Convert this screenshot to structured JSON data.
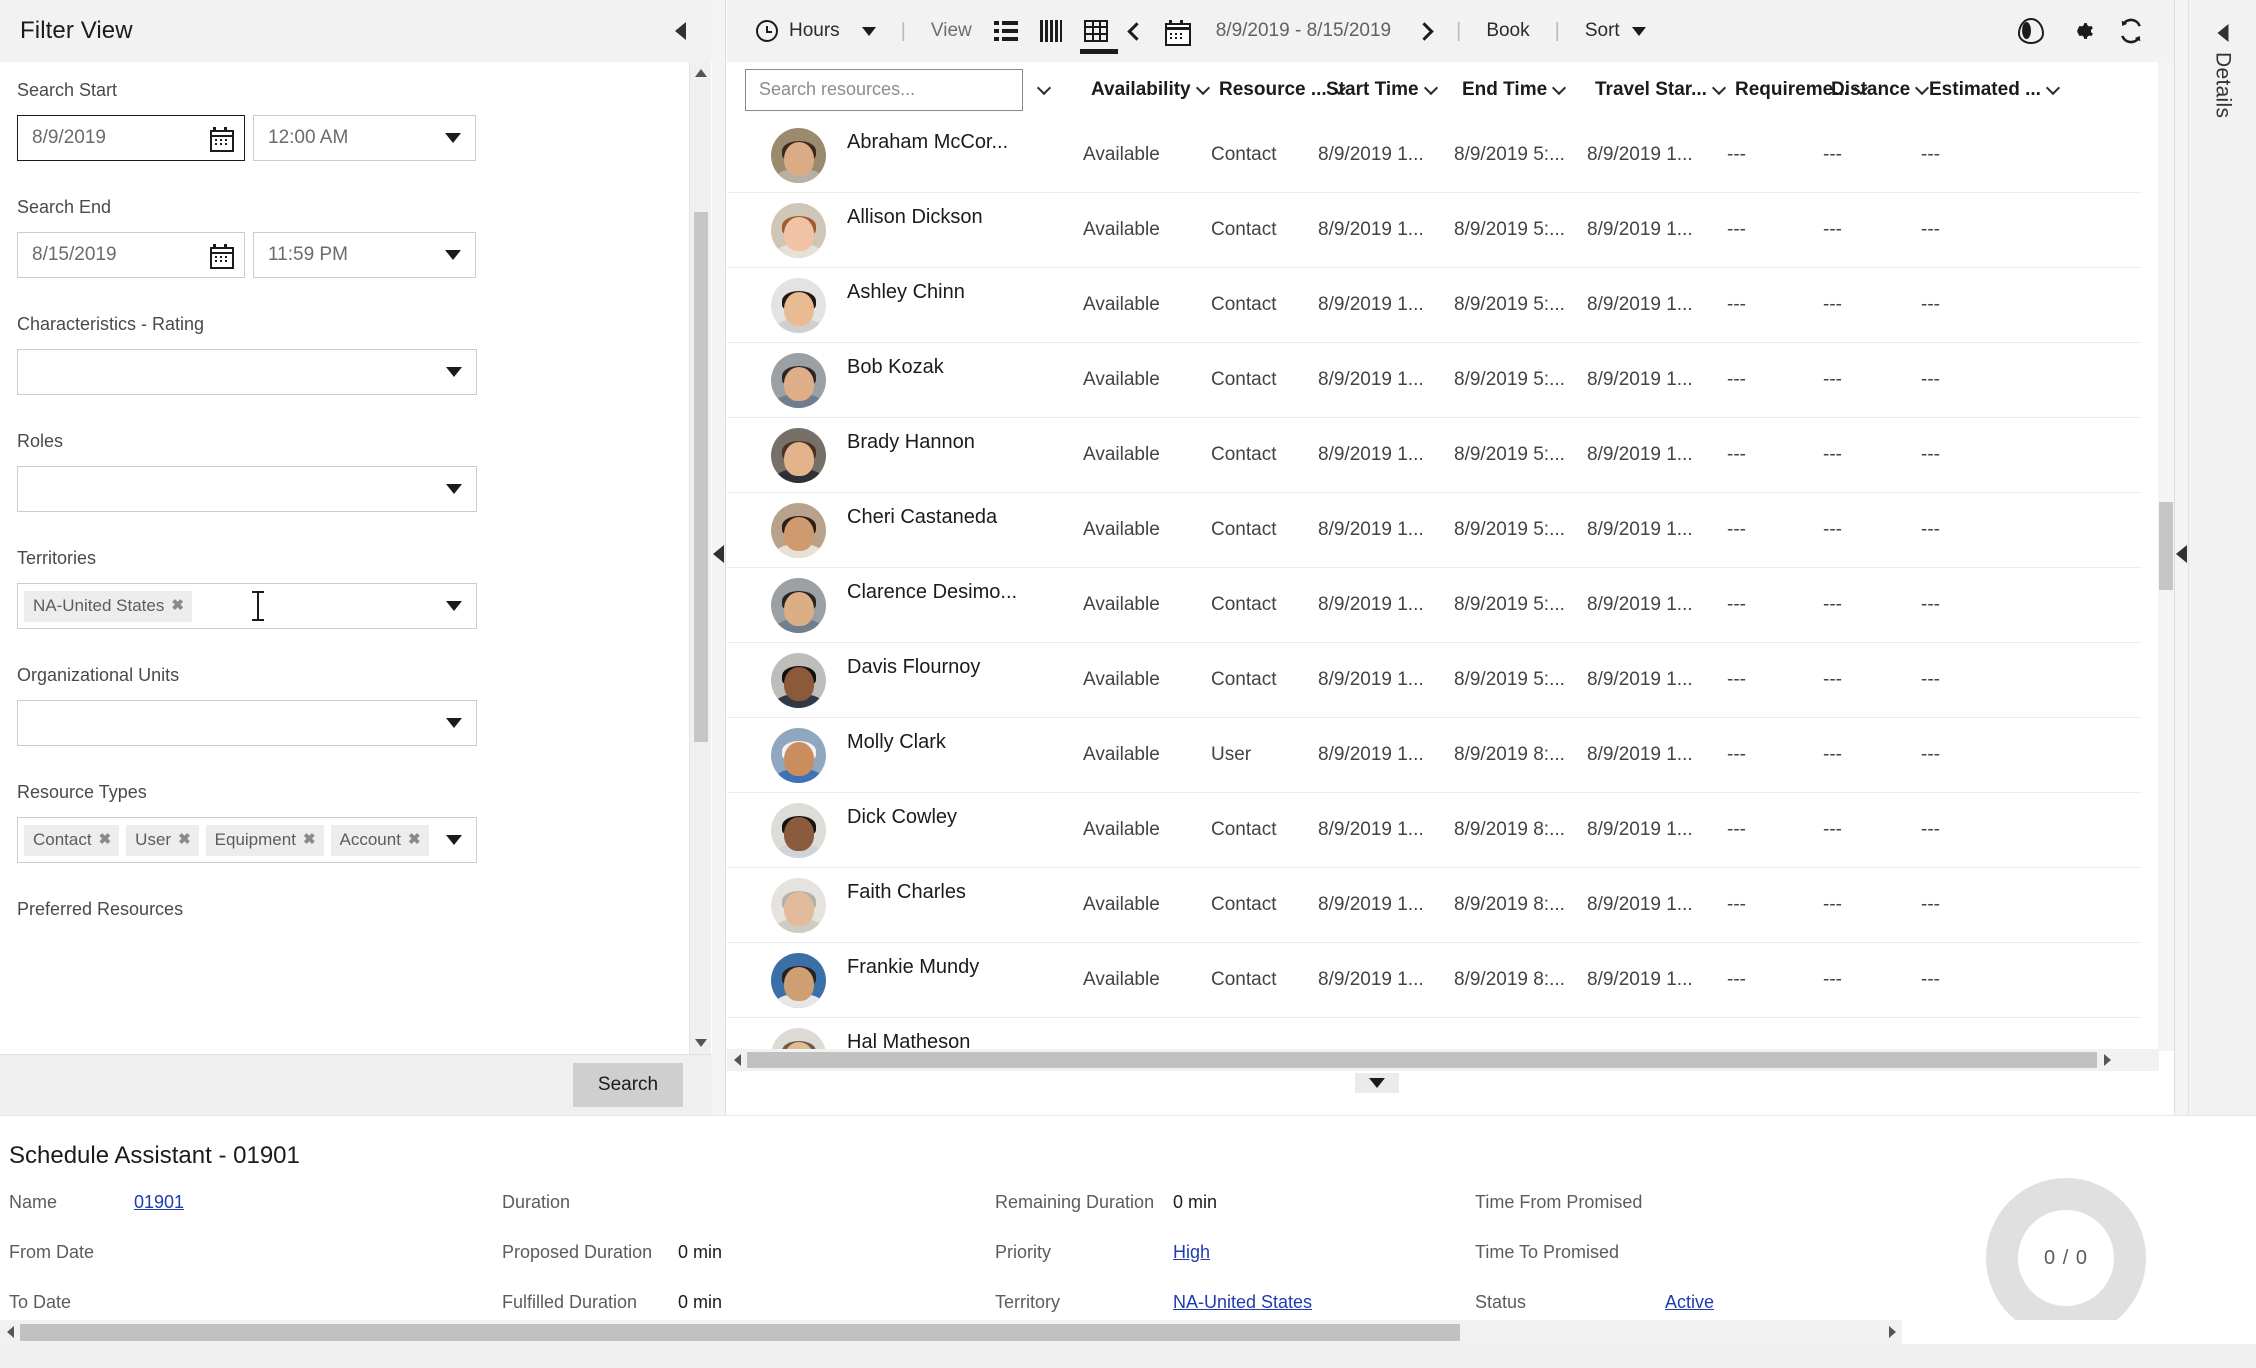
{
  "filter_panel": {
    "title": "Filter View",
    "collapse_icon": "chevron-left-icon",
    "fields": {
      "search_start": {
        "label": "Search Start",
        "date_value": "8/9/2019",
        "time_value": "12:00 AM",
        "calendar_icon": "calendar-icon",
        "dropdown_icon": "caret-down-icon"
      },
      "search_end": {
        "label": "Search End",
        "date_value": "8/15/2019",
        "time_value": "11:59 PM",
        "calendar_icon": "calendar-icon",
        "dropdown_icon": "caret-down-icon"
      },
      "characteristics_rating": {
        "label": "Characteristics - Rating",
        "chips": []
      },
      "roles": {
        "label": "Roles",
        "chips": []
      },
      "territories": {
        "label": "Territories",
        "chips": [
          "NA-United States"
        ]
      },
      "organizational_units": {
        "label": "Organizational Units",
        "chips": []
      },
      "resource_types": {
        "label": "Resource Types",
        "chips": [
          "Contact",
          "User",
          "Equipment",
          "Account"
        ]
      },
      "preferred_resources": {
        "label": "Preferred Resources"
      }
    },
    "search_button": "Search"
  },
  "toolbar": {
    "hours_label": "Hours",
    "hours_icon": "clock-icon",
    "hours_caret": "caret-down-icon",
    "view_label": "View",
    "list_icon": "list-view-icon",
    "columns_icon": "column-view-icon",
    "grid_icon": "grid-view-icon",
    "prev_icon": "chevron-left-icon",
    "calendar_icon": "calendar-icon",
    "date_range": "8/9/2019 - 8/15/2019",
    "next_icon": "chevron-right-icon",
    "book_label": "Book",
    "sort_label": "Sort",
    "sort_caret": "caret-down-icon",
    "eye_icon": "eye-icon",
    "settings_icon": "gear-icon",
    "refresh_icon": "refresh-icon",
    "separator": "|"
  },
  "grid": {
    "search_placeholder": "Search resources...",
    "search_value": "",
    "columns": [
      {
        "label": "Availability",
        "sort_icon": "chevron-down-icon"
      },
      {
        "label": "Resource ...",
        "sort_icon": "chevron-down-icon"
      },
      {
        "label": "Start Time",
        "sort_icon": "chevron-down-icon"
      },
      {
        "label": "End Time",
        "sort_icon": "chevron-down-icon"
      },
      {
        "label": "Travel Star...",
        "sort_icon": "chevron-down-icon"
      },
      {
        "label": "Requireme...",
        "sort_icon": "chevron-down-icon"
      },
      {
        "label": "Distance",
        "sort_icon": "chevron-down-icon"
      },
      {
        "label": "Estimated ...",
        "sort_icon": "chevron-down-icon"
      }
    ],
    "rows": [
      {
        "name": "Abraham McCor...",
        "availability": "Available",
        "resource_type": "Contact",
        "start_time": "8/9/2019 1...",
        "end_time": "8/9/2019 5:...",
        "travel_start": "8/9/2019 1...",
        "requirement": "---",
        "distance": "---",
        "estimated": "---",
        "avatar": {
          "skin": "#d9ac86",
          "hair": "#3a2a1e",
          "body": "#b9b0a4",
          "bg": "#9c8a6f"
        }
      },
      {
        "name": "Allison Dickson",
        "availability": "Available",
        "resource_type": "Contact",
        "start_time": "8/9/2019 1...",
        "end_time": "8/9/2019 5:...",
        "travel_start": "8/9/2019 1...",
        "requirement": "---",
        "distance": "---",
        "estimated": "---",
        "avatar": {
          "skin": "#f0c3a4",
          "hair": "#a05a2c",
          "body": "#e5e0d8",
          "bg": "#cfc6b8"
        }
      },
      {
        "name": "Ashley Chinn",
        "availability": "Available",
        "resource_type": "Contact",
        "start_time": "8/9/2019 1...",
        "end_time": "8/9/2019 5:...",
        "travel_start": "8/9/2019 1...",
        "requirement": "---",
        "distance": "---",
        "estimated": "---",
        "avatar": {
          "skin": "#e8bb92",
          "hair": "#201914",
          "body": "#cfcfcf",
          "bg": "#e3e3e1"
        }
      },
      {
        "name": "Bob Kozak",
        "availability": "Available",
        "resource_type": "Contact",
        "start_time": "8/9/2019 1...",
        "end_time": "8/9/2019 5:...",
        "travel_start": "8/9/2019 1...",
        "requirement": "---",
        "distance": "---",
        "estimated": "---",
        "avatar": {
          "skin": "#ddae87",
          "hair": "#2e2622",
          "body": "#6e7e8c",
          "bg": "#9aa0a4"
        }
      },
      {
        "name": "Brady Hannon",
        "availability": "Available",
        "resource_type": "Contact",
        "start_time": "8/9/2019 1...",
        "end_time": "8/9/2019 5:...",
        "travel_start": "8/9/2019 1...",
        "requirement": "---",
        "distance": "---",
        "estimated": "---",
        "avatar": {
          "skin": "#e3b38c",
          "hair": "#473227",
          "body": "#2d3036",
          "bg": "#777069"
        }
      },
      {
        "name": "Cheri Castaneda",
        "availability": "Available",
        "resource_type": "Contact",
        "start_time": "8/9/2019 1...",
        "end_time": "8/9/2019 5:...",
        "travel_start": "8/9/2019 1...",
        "requirement": "---",
        "distance": "---",
        "estimated": "---",
        "avatar": {
          "skin": "#cf9b6e",
          "hair": "#2b1d15",
          "body": "#e8e1d5",
          "bg": "#b9a28c"
        }
      },
      {
        "name": "Clarence Desimo...",
        "availability": "Available",
        "resource_type": "Contact",
        "start_time": "8/9/2019 1...",
        "end_time": "8/9/2019 5:...",
        "travel_start": "8/9/2019 1...",
        "requirement": "---",
        "distance": "---",
        "estimated": "---",
        "avatar": {
          "skin": "#dcae86",
          "hair": "#2b2320",
          "body": "#6f7f8d",
          "bg": "#9aa0a4"
        }
      },
      {
        "name": "Davis Flournoy",
        "availability": "Available",
        "resource_type": "Contact",
        "start_time": "8/9/2019 1...",
        "end_time": "8/9/2019 5:...",
        "travel_start": "8/9/2019 1...",
        "requirement": "---",
        "distance": "---",
        "estimated": "---",
        "avatar": {
          "skin": "#8a5a3a",
          "hair": "#150f0c",
          "body": "#2f3a46",
          "bg": "#bdbdbb"
        }
      },
      {
        "name": "Molly Clark",
        "availability": "Available",
        "resource_type": "User",
        "start_time": "8/9/2019 1...",
        "end_time": "8/9/2019 8:...",
        "travel_start": "8/9/2019 1...",
        "requirement": "---",
        "distance": "---",
        "estimated": "---",
        "avatar": {
          "skin": "#c98d5e",
          "hair": "#f2f2f2",
          "body": "#3f72b5",
          "bg": "#8fa7bf"
        }
      },
      {
        "name": "Dick Cowley",
        "availability": "Available",
        "resource_type": "Contact",
        "start_time": "8/9/2019 1...",
        "end_time": "8/9/2019 8:...",
        "travel_start": "8/9/2019 1...",
        "requirement": "---",
        "distance": "---",
        "estimated": "---",
        "avatar": {
          "skin": "#8a5b3c",
          "hair": "#171110",
          "body": "#cfd4d8",
          "bg": "#dcdcd8"
        }
      },
      {
        "name": "Faith Charles",
        "availability": "Available",
        "resource_type": "Contact",
        "start_time": "8/9/2019 1...",
        "end_time": "8/9/2019 8:...",
        "travel_start": "8/9/2019 1...",
        "requirement": "---",
        "distance": "---",
        "estimated": "---",
        "avatar": {
          "skin": "#e2bb9c",
          "hair": "#b5b2ab",
          "body": "#cfcac2",
          "bg": "#e6e3de"
        }
      },
      {
        "name": "Frankie Mundy",
        "availability": "Available",
        "resource_type": "Contact",
        "start_time": "8/9/2019 1...",
        "end_time": "8/9/2019 8:...",
        "travel_start": "8/9/2019 1...",
        "requirement": "---",
        "distance": "---",
        "estimated": "---",
        "avatar": {
          "skin": "#cf9f74",
          "hair": "#262020",
          "body": "#e7e7e7",
          "bg": "#3b6fa8"
        }
      },
      {
        "name": "Hal Matheson",
        "availability": "",
        "resource_type": "",
        "start_time": "",
        "end_time": "",
        "travel_start": "",
        "requirement": "",
        "distance": "",
        "estimated": "",
        "avatar": {
          "skin": "#e0bb96",
          "hair": "#6c5a4a",
          "body": "#d8d3cb",
          "bg": "#dedad4"
        }
      }
    ]
  },
  "details_rail": {
    "label": "Details",
    "collapse_icon": "chevron-left-icon"
  },
  "bottom_panel": {
    "title": "Schedule Assistant - 01901",
    "columns": [
      {
        "rows": [
          {
            "key": "Name",
            "value": "01901",
            "is_link": true
          },
          {
            "key": "From Date",
            "value": "",
            "is_link": false
          },
          {
            "key": "To Date",
            "value": "",
            "is_link": false
          }
        ]
      },
      {
        "rows": [
          {
            "key": "Duration",
            "value": "",
            "is_link": false
          },
          {
            "key": "Proposed Duration",
            "value": "0 min",
            "is_link": false
          },
          {
            "key": "Fulfilled Duration",
            "value": "0 min",
            "is_link": false
          }
        ]
      },
      {
        "rows": [
          {
            "key": "Remaining Duration",
            "value": "0 min",
            "is_link": false
          },
          {
            "key": "Priority",
            "value": "High",
            "is_link": true
          },
          {
            "key": "Territory",
            "value": "NA-United States",
            "is_link": true
          }
        ]
      },
      {
        "rows": [
          {
            "key": "Time From Promised",
            "value": "",
            "is_link": false
          },
          {
            "key": "Time To Promised",
            "value": "",
            "is_link": false
          },
          {
            "key": "Status",
            "value": "Active",
            "is_link": true
          }
        ]
      }
    ],
    "progress": "0 / 0"
  },
  "colors": {
    "accent_link": "#1f3bb3",
    "toolbar_bg": "#f2f2f2",
    "chip_bg": "#ededed",
    "scrollbar_thumb": "#c1c1c1",
    "ring_bg": "#e0e0e0"
  }
}
